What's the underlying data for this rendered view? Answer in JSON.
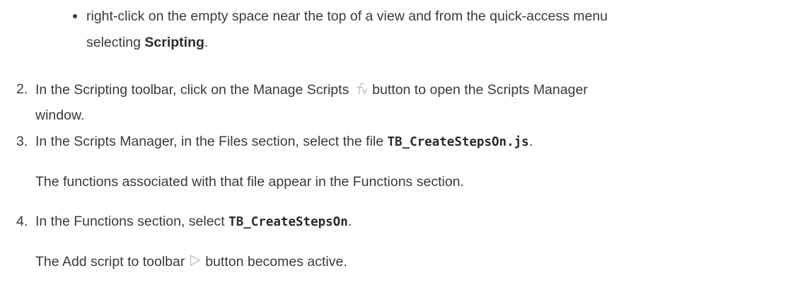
{
  "bullet": {
    "line1": "right-click on the empty space near the top of a view and from the quick-access menu",
    "line2_pre": "selecting ",
    "line2_bold": "Scripting",
    "line2_post": "."
  },
  "steps": [
    {
      "number": "2.",
      "pre": "In the Scripting toolbar, click on the Manage Scripts ",
      "icon": "manage-scripts-icon",
      "post": " button to open the Scripts Manager",
      "line2": "window."
    },
    {
      "number": "3.",
      "pre": "In the Scripts Manager, in the Files section, select the file ",
      "code": "TB_CreateStepsOn.js",
      "post": ".",
      "note": "The functions associated with that file appear in the Functions section."
    },
    {
      "number": "4.",
      "pre": "In the Functions section, select ",
      "code": "TB_CreateStepsOn",
      "post": ".",
      "note_pre": "The Add script to toolbar ",
      "note_icon": "add-script-icon",
      "note_post": " button becomes active."
    }
  ],
  "colors": {
    "text": "#3a3a3a",
    "icon": "#bfbfbf"
  }
}
